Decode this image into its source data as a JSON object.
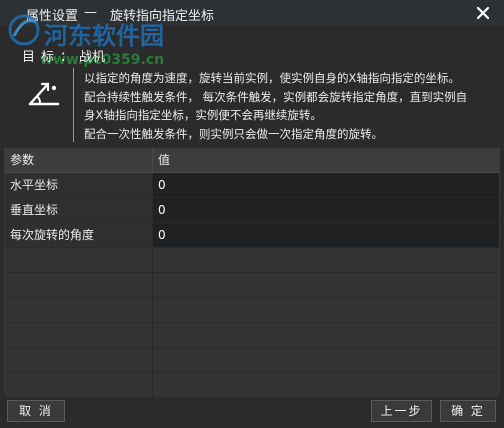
{
  "window": {
    "title_prefix": "属性设置",
    "title_sep": "—",
    "title": "旋转指向指定坐标",
    "close_icon": "close-icon"
  },
  "watermark": {
    "brand": "河东软件园",
    "url": "www.pc0359.cn"
  },
  "target": {
    "label": "目标：",
    "value": "战机"
  },
  "description": [
    "以指定的角度为速度，旋转当前实例，使实例自身的X轴指向指定的坐标。",
    "配合持续性触发条件， 每次条件触发，实例都会旋转指定角度，直到实例自",
    "身X轴指向指定坐标，实例便不会再继续旋转。",
    "配合一次性触发条件，则实例只会做一次指定角度的旋转。"
  ],
  "table": {
    "headers": [
      "参数",
      "值"
    ],
    "rows": [
      {
        "name": "水平坐标",
        "value": "0"
      },
      {
        "name": "垂直坐标",
        "value": "0"
      },
      {
        "name": "每次旋转的角度",
        "value": "0"
      }
    ],
    "empty_rows": 6
  },
  "buttons": {
    "cancel": "取 消",
    "prev": "上一步",
    "ok": "确 定"
  },
  "colors": {
    "background": "#2b2b2b",
    "value_cell": "#1f2123",
    "watermark_blue": "#1f6fb5"
  }
}
